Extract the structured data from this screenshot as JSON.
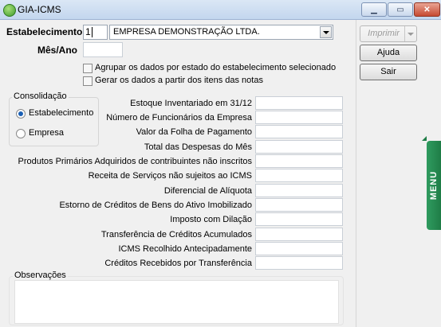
{
  "window": {
    "title": "GIA-ICMS"
  },
  "header": {
    "estabelecimento_label": "Estabelecimento",
    "estabelecimento_code": "1",
    "estabelecimento_name": "EMPRESA DEMONSTRAÇÃO LTDA.",
    "mes_ano_label": "Mês/Ano",
    "mes_ano_value": ""
  },
  "options": {
    "agrupar_label": "Agrupar os dados por estado do estabelecimento selecionado",
    "gerar_label": "Gerar os dados a partir dos itens das notas"
  },
  "consolidacao": {
    "title": "Consolidação",
    "options": [
      {
        "label": "Estabelecimento",
        "selected": true
      },
      {
        "label": "Empresa",
        "selected": false
      }
    ]
  },
  "fields": [
    {
      "label": "Estoque Inventariado em 31/12",
      "value": ""
    },
    {
      "label": "Número de Funcionários da Empresa",
      "value": ""
    },
    {
      "label": "Valor da Folha de Pagamento",
      "value": ""
    },
    {
      "label": "Total das Despesas do Mês",
      "value": ""
    },
    {
      "label": "Produtos Primários Adquiridos de contribuintes não inscritos",
      "value": ""
    },
    {
      "label": "Receita de Serviços não sujeitos ao ICMS",
      "value": ""
    },
    {
      "label": "Diferencial de Alíquota",
      "value": ""
    },
    {
      "label": "Estorno de Créditos de Bens do Ativo Imobilizado",
      "value": ""
    },
    {
      "label": "Imposto com Dilação",
      "value": ""
    },
    {
      "label": "Transferência de Créditos Acumulados",
      "value": ""
    },
    {
      "label": "ICMS Recolhido Antecipadamente",
      "value": ""
    },
    {
      "label": "Créditos Recebidos por Transferência",
      "value": ""
    }
  ],
  "observacoes": {
    "title": "Observações",
    "value": ""
  },
  "buttons": {
    "imprimir": "Imprimir",
    "ajuda": "Ajuda",
    "sair": "Sair"
  },
  "side_tab": {
    "label": "MENU"
  }
}
